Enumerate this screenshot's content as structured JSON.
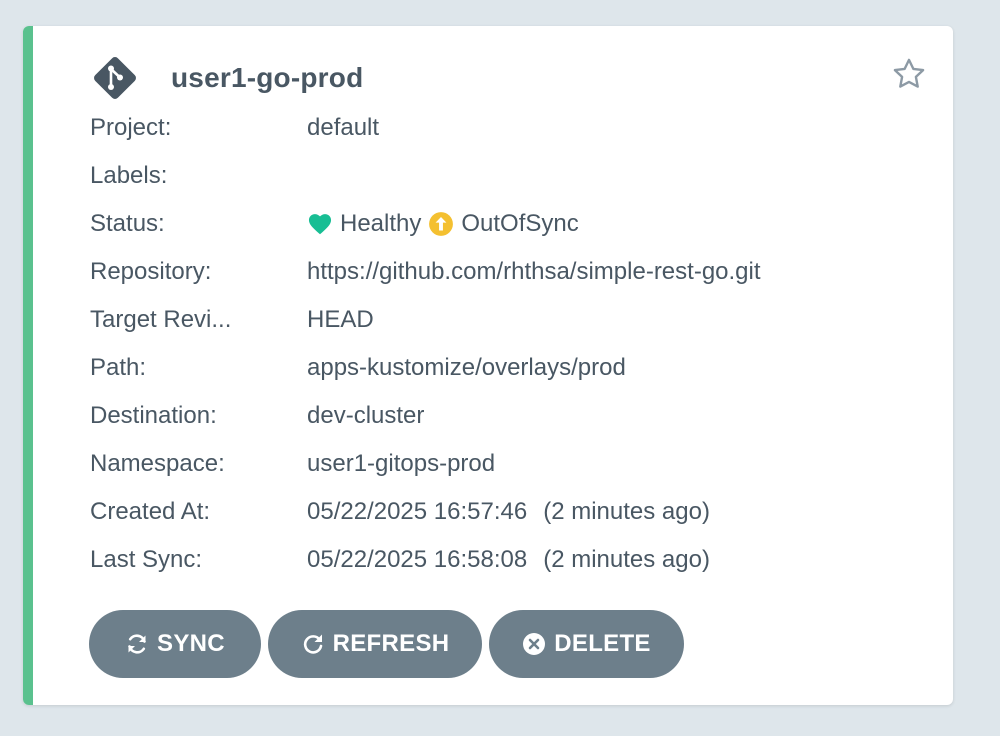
{
  "app": {
    "name": "user1-go-prod",
    "accent_color": "#5ac18e",
    "icon": "git-icon",
    "favorite_icon": "star-outline-icon"
  },
  "fields": [
    {
      "key": "project",
      "label": "Project:",
      "value": "default"
    },
    {
      "key": "labels",
      "label": "Labels:",
      "value": ""
    },
    {
      "key": "status",
      "label": "Status:",
      "health": "Healthy",
      "health_color": "#18be94",
      "health_icon": "heart-icon",
      "sync": "OutOfSync",
      "sync_color": "#f4c030",
      "sync_icon": "arrow-up-circle-icon"
    },
    {
      "key": "repository",
      "label": "Repository:",
      "value": "https://github.com/rhthsa/simple-rest-go.git"
    },
    {
      "key": "target_revision",
      "label": "Target Revi...",
      "value": "HEAD"
    },
    {
      "key": "path",
      "label": "Path:",
      "value": "apps-kustomize/overlays/prod"
    },
    {
      "key": "destination",
      "label": "Destination:",
      "value": "dev-cluster"
    },
    {
      "key": "namespace",
      "label": "Namespace:",
      "value": "user1-gitops-prod"
    },
    {
      "key": "created_at",
      "label": "Created At:",
      "value": "05/22/2025 16:57:46",
      "ago": "(2 minutes ago)"
    },
    {
      "key": "last_sync",
      "label": "Last Sync:",
      "value": "05/22/2025 16:58:08",
      "ago": "(2 minutes ago)"
    }
  ],
  "actions": {
    "sync": {
      "label": "SYNC",
      "icon": "sync-icon"
    },
    "refresh": {
      "label": "REFRESH",
      "icon": "refresh-icon"
    },
    "delete": {
      "label": "DELETE",
      "icon": "times-circle-icon"
    }
  }
}
